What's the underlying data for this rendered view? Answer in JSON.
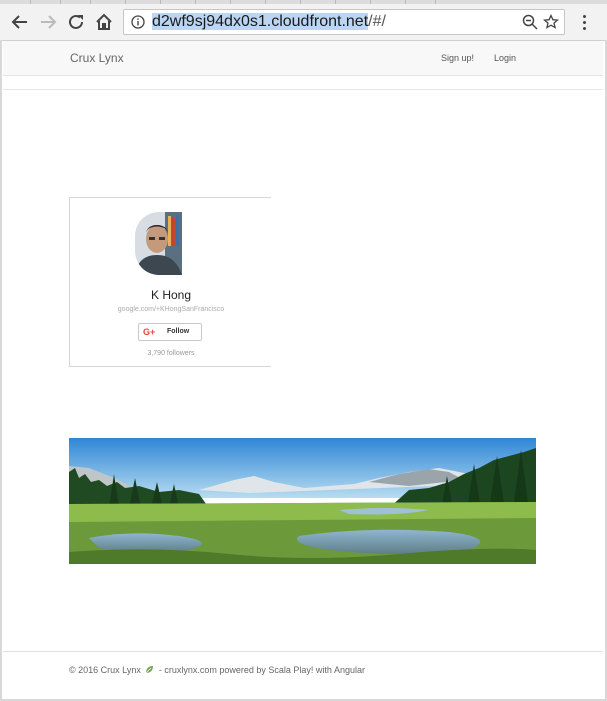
{
  "browser": {
    "url_host": "d2wf9sj94dx0s1.cloudfront.net",
    "url_path": "/#/",
    "icons": [
      "back-icon",
      "forward-icon",
      "reload-icon",
      "home-icon",
      "info-icon",
      "zoom-out-icon",
      "bookmark-star-icon",
      "kebab-menu-icon"
    ]
  },
  "navbar": {
    "brand": "Crux Lynx",
    "signup": "Sign up!",
    "login": "Login"
  },
  "gplus_badge": {
    "name": "K Hong",
    "profile_url": "google.com/+KHongSanFrancisco",
    "follow_label": "Follow",
    "gplus_icon": "G+",
    "followers": "3,790 followers",
    "brand_color": "#dd4b39"
  },
  "footer": {
    "copyright": "© 2016 Crux Lynx",
    "rest": "- cruxlynx.com powered by Scala Play! with Angular"
  }
}
